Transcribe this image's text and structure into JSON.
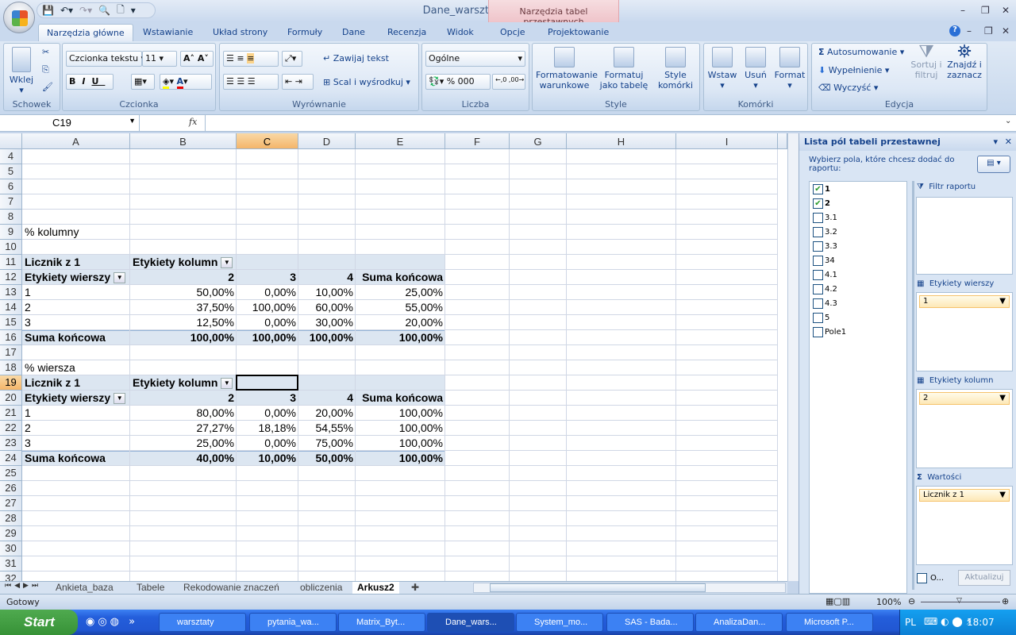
{
  "window": {
    "title": "Dane_warsztaty - Microsoft Excel",
    "context_tab": "Narzędzia tabel przestawnych"
  },
  "ribbon_tabs": [
    "Narzędzia główne",
    "Wstawianie",
    "Układ strony",
    "Formuły",
    "Dane",
    "Recenzja",
    "Widok",
    "Opcje",
    "Projektowanie"
  ],
  "ribbon": {
    "clipboard": {
      "label": "Schowek",
      "paste": "Wklej"
    },
    "font": {
      "label": "Czcionka",
      "name": "Czcionka tekstu",
      "size": "11",
      "bold": "B",
      "italic": "I",
      "underline": "U"
    },
    "alignment": {
      "label": "Wyrównanie",
      "wrap": "Zawijaj tekst",
      "merge": "Scal i wyśrodkuj"
    },
    "number": {
      "label": "Liczba",
      "format": "Ogólne",
      "percent": "%",
      "thousands": "000"
    },
    "styles": {
      "label": "Style",
      "conditional": "Formatowanie warunkowe",
      "as_table": "Formatuj jako tabelę",
      "cell_styles": "Style komórki"
    },
    "cells": {
      "label": "Komórki",
      "insert": "Wstaw",
      "delete": "Usuń",
      "format": "Format"
    },
    "editing": {
      "label": "Edycja",
      "autosum": "Autosumowanie",
      "fill": "Wypełnienie",
      "clear": "Wyczyść",
      "sort": "Sortuj i filtruj",
      "find": "Znajdź i zaznacz"
    }
  },
  "formula_bar": {
    "name_box": "C19",
    "fx": "fx",
    "value": ""
  },
  "columns": [
    "A",
    "B",
    "C",
    "D",
    "E",
    "F",
    "G",
    "H",
    "I"
  ],
  "selected_cell": "C19",
  "rows_visible": [
    4,
    32
  ],
  "cells": [
    {
      "r": 9,
      "c": "A",
      "v": "% kolumny"
    },
    {
      "r": 11,
      "c": "A",
      "v": "Licznik z 1",
      "b": true
    },
    {
      "r": 11,
      "c": "B",
      "v": "Etykiety kolumn",
      "b": true,
      "dd": true
    },
    {
      "r": 12,
      "c": "A",
      "v": "Etykiety wierszy",
      "b": true,
      "dd": true
    },
    {
      "r": 12,
      "c": "B",
      "v": "2",
      "b": true,
      "right": true
    },
    {
      "r": 12,
      "c": "C",
      "v": "3",
      "b": true,
      "right": true
    },
    {
      "r": 12,
      "c": "D",
      "v": "4",
      "b": true,
      "right": true
    },
    {
      "r": 12,
      "c": "E",
      "v": "Suma końcowa",
      "b": true,
      "right": true
    },
    {
      "r": 13,
      "c": "A",
      "v": "1"
    },
    {
      "r": 13,
      "c": "B",
      "v": "50,00%",
      "right": true
    },
    {
      "r": 13,
      "c": "C",
      "v": "0,00%",
      "right": true
    },
    {
      "r": 13,
      "c": "D",
      "v": "10,00%",
      "right": true
    },
    {
      "r": 13,
      "c": "E",
      "v": "25,00%",
      "right": true
    },
    {
      "r": 14,
      "c": "A",
      "v": "2"
    },
    {
      "r": 14,
      "c": "B",
      "v": "37,50%",
      "right": true
    },
    {
      "r": 14,
      "c": "C",
      "v": "100,00%",
      "right": true
    },
    {
      "r": 14,
      "c": "D",
      "v": "60,00%",
      "right": true
    },
    {
      "r": 14,
      "c": "E",
      "v": "55,00%",
      "right": true
    },
    {
      "r": 15,
      "c": "A",
      "v": "3"
    },
    {
      "r": 15,
      "c": "B",
      "v": "12,50%",
      "right": true
    },
    {
      "r": 15,
      "c": "C",
      "v": "0,00%",
      "right": true
    },
    {
      "r": 15,
      "c": "D",
      "v": "30,00%",
      "right": true
    },
    {
      "r": 15,
      "c": "E",
      "v": "20,00%",
      "right": true
    },
    {
      "r": 16,
      "c": "A",
      "v": "Suma końcowa",
      "b": true
    },
    {
      "r": 16,
      "c": "B",
      "v": "100,00%",
      "b": true,
      "right": true
    },
    {
      "r": 16,
      "c": "C",
      "v": "100,00%",
      "b": true,
      "right": true
    },
    {
      "r": 16,
      "c": "D",
      "v": "100,00%",
      "b": true,
      "right": true
    },
    {
      "r": 16,
      "c": "E",
      "v": "100,00%",
      "b": true,
      "right": true
    },
    {
      "r": 18,
      "c": "A",
      "v": "% wiersza"
    },
    {
      "r": 19,
      "c": "A",
      "v": "Licznik z 1",
      "b": true
    },
    {
      "r": 19,
      "c": "B",
      "v": "Etykiety kolumn",
      "b": true,
      "dd": true
    },
    {
      "r": 20,
      "c": "A",
      "v": "Etykiety wierszy",
      "b": true,
      "dd": true
    },
    {
      "r": 20,
      "c": "B",
      "v": "2",
      "b": true,
      "right": true
    },
    {
      "r": 20,
      "c": "C",
      "v": "3",
      "b": true,
      "right": true
    },
    {
      "r": 20,
      "c": "D",
      "v": "4",
      "b": true,
      "right": true
    },
    {
      "r": 20,
      "c": "E",
      "v": "Suma końcowa",
      "b": true,
      "right": true
    },
    {
      "r": 21,
      "c": "A",
      "v": "1"
    },
    {
      "r": 21,
      "c": "B",
      "v": "80,00%",
      "right": true
    },
    {
      "r": 21,
      "c": "C",
      "v": "0,00%",
      "right": true
    },
    {
      "r": 21,
      "c": "D",
      "v": "20,00%",
      "right": true
    },
    {
      "r": 21,
      "c": "E",
      "v": "100,00%",
      "right": true
    },
    {
      "r": 22,
      "c": "A",
      "v": "2"
    },
    {
      "r": 22,
      "c": "B",
      "v": "27,27%",
      "right": true
    },
    {
      "r": 22,
      "c": "C",
      "v": "18,18%",
      "right": true
    },
    {
      "r": 22,
      "c": "D",
      "v": "54,55%",
      "right": true
    },
    {
      "r": 22,
      "c": "E",
      "v": "100,00%",
      "right": true
    },
    {
      "r": 23,
      "c": "A",
      "v": "3"
    },
    {
      "r": 23,
      "c": "B",
      "v": "25,00%",
      "right": true
    },
    {
      "r": 23,
      "c": "C",
      "v": "0,00%",
      "right": true
    },
    {
      "r": 23,
      "c": "D",
      "v": "75,00%",
      "right": true
    },
    {
      "r": 23,
      "c": "E",
      "v": "100,00%",
      "right": true
    },
    {
      "r": 24,
      "c": "A",
      "v": "Suma końcowa",
      "b": true
    },
    {
      "r": 24,
      "c": "B",
      "v": "40,00%",
      "b": true,
      "right": true
    },
    {
      "r": 24,
      "c": "C",
      "v": "10,00%",
      "b": true,
      "right": true
    },
    {
      "r": 24,
      "c": "D",
      "v": "50,00%",
      "b": true,
      "right": true
    },
    {
      "r": 24,
      "c": "E",
      "v": "100,00%",
      "b": true,
      "right": true
    }
  ],
  "band_rows": [
    11,
    12,
    16,
    19,
    20,
    24
  ],
  "total_rows": [
    16,
    24
  ],
  "pivot_panel": {
    "title": "Lista pól tabeli przestawnej",
    "instruction": "Wybierz pola, które chcesz dodać do raportu:",
    "fields": [
      {
        "name": "1",
        "checked": true
      },
      {
        "name": "2",
        "checked": true
      },
      {
        "name": "3.1",
        "checked": false
      },
      {
        "name": "3.2",
        "checked": false
      },
      {
        "name": "3.3",
        "checked": false
      },
      {
        "name": "34",
        "checked": false
      },
      {
        "name": "4.1",
        "checked": false
      },
      {
        "name": "4.2",
        "checked": false
      },
      {
        "name": "4.3",
        "checked": false
      },
      {
        "name": "5",
        "checked": false
      },
      {
        "name": "Pole1",
        "checked": false
      }
    ],
    "report_filter": "Filtr raportu",
    "row_labels": "Etykiety wierszy",
    "row_field": "1",
    "column_labels": "Etykiety kolumn",
    "column_field": "2",
    "values": "Wartości",
    "values_field": "Licznik z 1",
    "defer_label": "O...",
    "update": "Aktualizuj"
  },
  "sheet_tabs": [
    "Ankieta_baza",
    "Tabele",
    "Rekodowanie znaczeń",
    "obliczenia",
    "Arkusz2"
  ],
  "active_sheet": "Arkusz2",
  "status": {
    "text": "Gotowy",
    "zoom": "100%"
  },
  "taskbar": {
    "start": "Start",
    "items": [
      "warsztaty",
      "pytania_wa...",
      "Matrix_Byt...",
      "Dane_wars...",
      "System_mo...",
      "SAS - Bada...",
      "AnalizaDan...",
      "Microsoft P..."
    ],
    "active": "Dane_wars...",
    "lang": "PL",
    "clock": "18:07"
  }
}
